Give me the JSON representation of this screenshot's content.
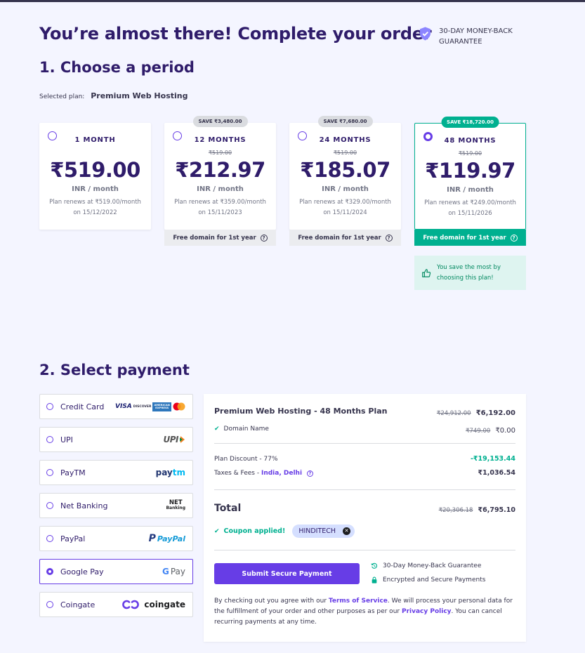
{
  "header": {
    "title": "You’re almost there! Complete your order",
    "guarantee_line1": "30-DAY MONEY-BACK",
    "guarantee_line2": "GUARANTEE"
  },
  "period_section": {
    "title": "1. Choose a period",
    "selected_plan_label": "Selected plan:",
    "selected_plan_value": "Premium Web Hosting",
    "cards": [
      {
        "duration": "1 MONTH",
        "save": "",
        "old_price": "",
        "price": "₹519.00",
        "per": "INR / month",
        "renew_line1": "Plan renews at ₹519.00/month",
        "renew_line2": "on 15/12/2022",
        "domain": "",
        "selected": false
      },
      {
        "duration": "12 MONTHS",
        "save": "SAVE ₹3,480.00",
        "old_price": "₹519.00",
        "price": "₹212.97",
        "per": "INR / month",
        "renew_line1": "Plan renews at ₹359.00/month",
        "renew_line2": "on 15/11/2023",
        "domain": "Free domain for 1st year",
        "selected": false
      },
      {
        "duration": "24 MONTHS",
        "save": "SAVE ₹7,680.00",
        "old_price": "₹519.00",
        "price": "₹185.07",
        "per": "INR / month",
        "renew_line1": "Plan renews at ₹329.00/month",
        "renew_line2": "on 15/11/2024",
        "domain": "Free domain for 1st year",
        "selected": false
      },
      {
        "duration": "48 MONTHS",
        "save": "SAVE ₹18,720.00",
        "old_price": "₹519.00",
        "price": "₹119.97",
        "per": "INR / month",
        "renew_line1": "Plan renews at ₹249.00/month",
        "renew_line2": "on 15/11/2026",
        "domain": "Free domain for 1st year",
        "selected": true
      }
    ],
    "save_note_line1": "You save the most by",
    "save_note_line2": "choosing this plan!"
  },
  "payment_section": {
    "title": "2. Select payment",
    "methods": [
      {
        "label": "Credit Card",
        "logo": "card-logos",
        "selected": false
      },
      {
        "label": "UPI",
        "logo": "upi-logo",
        "selected": false
      },
      {
        "label": "PayTM",
        "logo": "paytm-logo",
        "selected": false
      },
      {
        "label": "Net Banking",
        "logo": "net-banking-logo",
        "selected": false
      },
      {
        "label": "PayPal",
        "logo": "paypal-logo",
        "selected": false
      },
      {
        "label": "Google Pay",
        "logo": "gpay-logo",
        "selected": true
      },
      {
        "label": "Coingate",
        "logo": "coingate-logo",
        "selected": false
      }
    ],
    "logos": {
      "visa": "VISA",
      "discover": "DISCOVER",
      "amex_line1": "AMERICAN",
      "amex_line2": "EXPRESS",
      "upi": "UPI",
      "paytm_pay": "pay",
      "paytm_tm": "tm",
      "net_line1": "NET",
      "net_line2": "Banking",
      "paypal": "PayPal",
      "gpay_g": "G",
      "gpay_pay": "Pay",
      "coingate": "coingate"
    }
  },
  "summary": {
    "plan_title": "Premium Web Hosting - 48 Months Plan",
    "plan_old": "₹24,912.00",
    "plan_price": "₹6,192.00",
    "domain_label": "Domain Name",
    "domain_old": "₹749.00",
    "domain_price": "₹0.00",
    "discount_label": "Plan Discount - 77%",
    "discount_value": "-₹19,153.44",
    "taxes_label": "Taxes & Fees -",
    "taxes_location": "India, Delhi",
    "taxes_value": "₹1,036.54",
    "total_label": "Total",
    "total_old": "₹20,306.18",
    "total_value": "₹6,795.10",
    "coupon_label": "Coupon applied!",
    "coupon_code": "HINDITECH",
    "submit_label": "Submit Secure Payment",
    "assurance_1": "30-Day Money-Back Guarantee",
    "assurance_2": "Encrypted and Secure Payments",
    "terms_1": "By checking out you agree with our ",
    "terms_link_1": "Terms of Service",
    "terms_2": ". We will process your personal data for the fulfillment of your order and other purposes as per our ",
    "terms_link_2": "Privacy Policy",
    "terms_3": ". You can cancel recurring payments at any time."
  },
  "colors": {
    "primary": "#673de6",
    "heading": "#2f1c6a",
    "success": "#00b090",
    "background": "#f4f5ff"
  }
}
